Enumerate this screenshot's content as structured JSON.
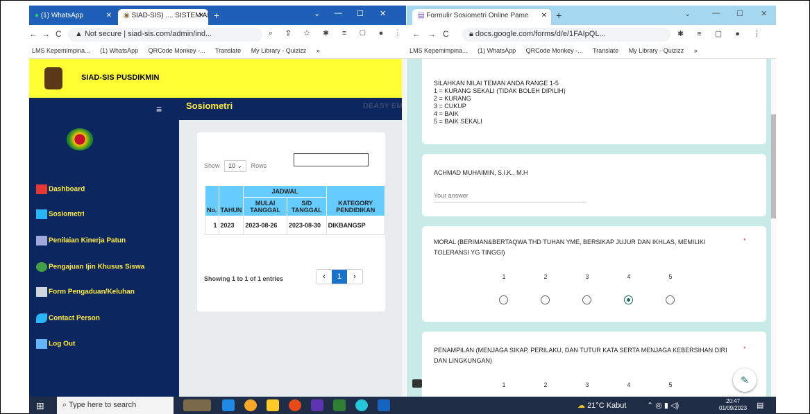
{
  "left_browser": {
    "tabs": [
      {
        "label": "(1) WhatsApp"
      },
      {
        "label": "SIAD-SIS) .... SISTEM ADM"
      }
    ],
    "url": "Not secure | siad-sis.com/admin/ind...",
    "bookmarks": [
      "LMS Kepemimpina...",
      "(1) WhatsApp",
      "QRCode Monkey -...",
      "Translate",
      "My Library - Quizizz",
      "»"
    ]
  },
  "left_page": {
    "brand": "SIAD-SIS PUSDIKMIN",
    "page_title": "Sosiometri",
    "user_line": "DEASY EMILIYA, S.M. | Level : SISWA",
    "sidebar": [
      {
        "label": "Dashboard",
        "icon": "home-icon",
        "color": "#e53935"
      },
      {
        "label": "Sosiometri",
        "icon": "chart-icon",
        "color": "#29b6f6"
      },
      {
        "label": "Penilaian Kinerja Patun",
        "icon": "document-icon",
        "color": "#9fa8da"
      },
      {
        "label": "Pengajuan Ijin Khusus Siswa",
        "icon": "check-icon",
        "color": "#43a047"
      },
      {
        "label": "Form Pengaduan/Keluhan",
        "icon": "image-icon",
        "color": "#cfd8dc"
      },
      {
        "label": "Contact Person",
        "icon": "phone-icon",
        "color": "#29b6f6"
      },
      {
        "label": "Log Out",
        "icon": "logout-icon",
        "color": "#64b5f6"
      }
    ],
    "table": {
      "show_label": "Show",
      "rows_value": "10",
      "rows_label": "Rows",
      "group_header": "JADWAL",
      "headers": [
        "No.",
        "TAHUN",
        "MULAI TANGGAL",
        "S/D TANGGAL",
        "KATEGORY PENDIDIKAN"
      ],
      "rows": [
        [
          "1",
          "2023",
          "2023-08-26",
          "2023-08-30",
          "DIKBANGSP"
        ]
      ],
      "showing": "Showing 1 to 1 of 1 entries",
      "prev": "‹",
      "page": "1",
      "next": "›"
    }
  },
  "right_browser": {
    "tab": "Formulir Sosiometri Online Pame",
    "url": "docs.google.com/forms/d/e/1FAIpQL...",
    "bookmarks": [
      "LMS Kepemimpina...",
      "(1) WhatsApp",
      "QRCode Monkey -...",
      "Translate",
      "My Library - Quizizz",
      "»"
    ]
  },
  "form": {
    "instructions": [
      "SILAHKAN NILAI TEMAN ANDA RANGE 1-5",
      "1 = KURANG SEKALI (TIDAK BOLEH DIPILIH)",
      "2 = KURANG",
      "3 = CUKUP",
      "4 = BAIK",
      "5 = BAIK SEKALI"
    ],
    "name_question": "ACHMAD MUHAIMIN, S.I.K., M.H",
    "answer_placeholder": "Your answer",
    "q1": "MORAL (BERIMAN&BERTAQWA THD TUHAN YME, BERSIKAP JUJUR DAN IKHLAS, MEMILIKI TOLERANSI YG TINGGI)",
    "q2": "PENAMPILAN (MENJAGA SIKAP, PERILAKU, DAN TUTUR KATA SERTA MENJAGA KEBERSIHAN DIRI DAN LINGKUNGAN)",
    "scale": [
      "1",
      "2",
      "3",
      "4",
      "5"
    ],
    "q1_selected": 4,
    "required_mark": "*"
  },
  "taskbar": {
    "search_placeholder": "Type here to search",
    "weather": "21°C Kabut",
    "time": "20:47",
    "date": "01/09/2023"
  }
}
